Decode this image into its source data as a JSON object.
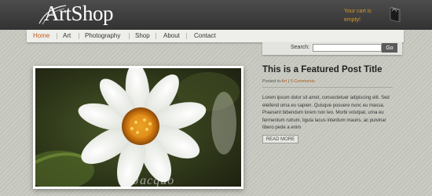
{
  "site": {
    "logo_text": "ArtShop",
    "cart_text": "Your cart is empty!"
  },
  "nav": {
    "items": [
      {
        "label": "Home",
        "active": true
      },
      {
        "label": "Art",
        "active": false
      },
      {
        "label": "Photography",
        "active": false
      },
      {
        "label": "Shop",
        "active": false
      },
      {
        "label": "About",
        "active": false
      },
      {
        "label": "Contact",
        "active": false
      }
    ]
  },
  "search": {
    "label": "Search:",
    "value": "",
    "button_label": "Go"
  },
  "post": {
    "title": "This is a Featured Post Title",
    "meta_prefix": "Posted in",
    "category": "Art",
    "meta_sep": "|",
    "comments": "5 Comments",
    "body": "Lorem ipsum dolor sit amet, consectetuer adipiscing elit. Sed eleifend urna eu sapien. Quisque posuere nunc eu massa. Praesent bibendum lorem non leo. Morbi volutpat, urna eu fermentum rutrum, ligula lacus interdum mauris, ac pulvinar libero pede a enim",
    "read_more_label": "READ MORE",
    "image_watermark": "Jacquo"
  },
  "icons": {
    "cart": "shopping-bag-icon",
    "logo_swoosh": "swoosh-icon"
  },
  "colors": {
    "header_bg": "#3d3d3d",
    "accent_orange": "#d79a2a",
    "nav_active": "#c45b1c",
    "link": "#b05a1c",
    "content_bg": "#c8cac1"
  }
}
